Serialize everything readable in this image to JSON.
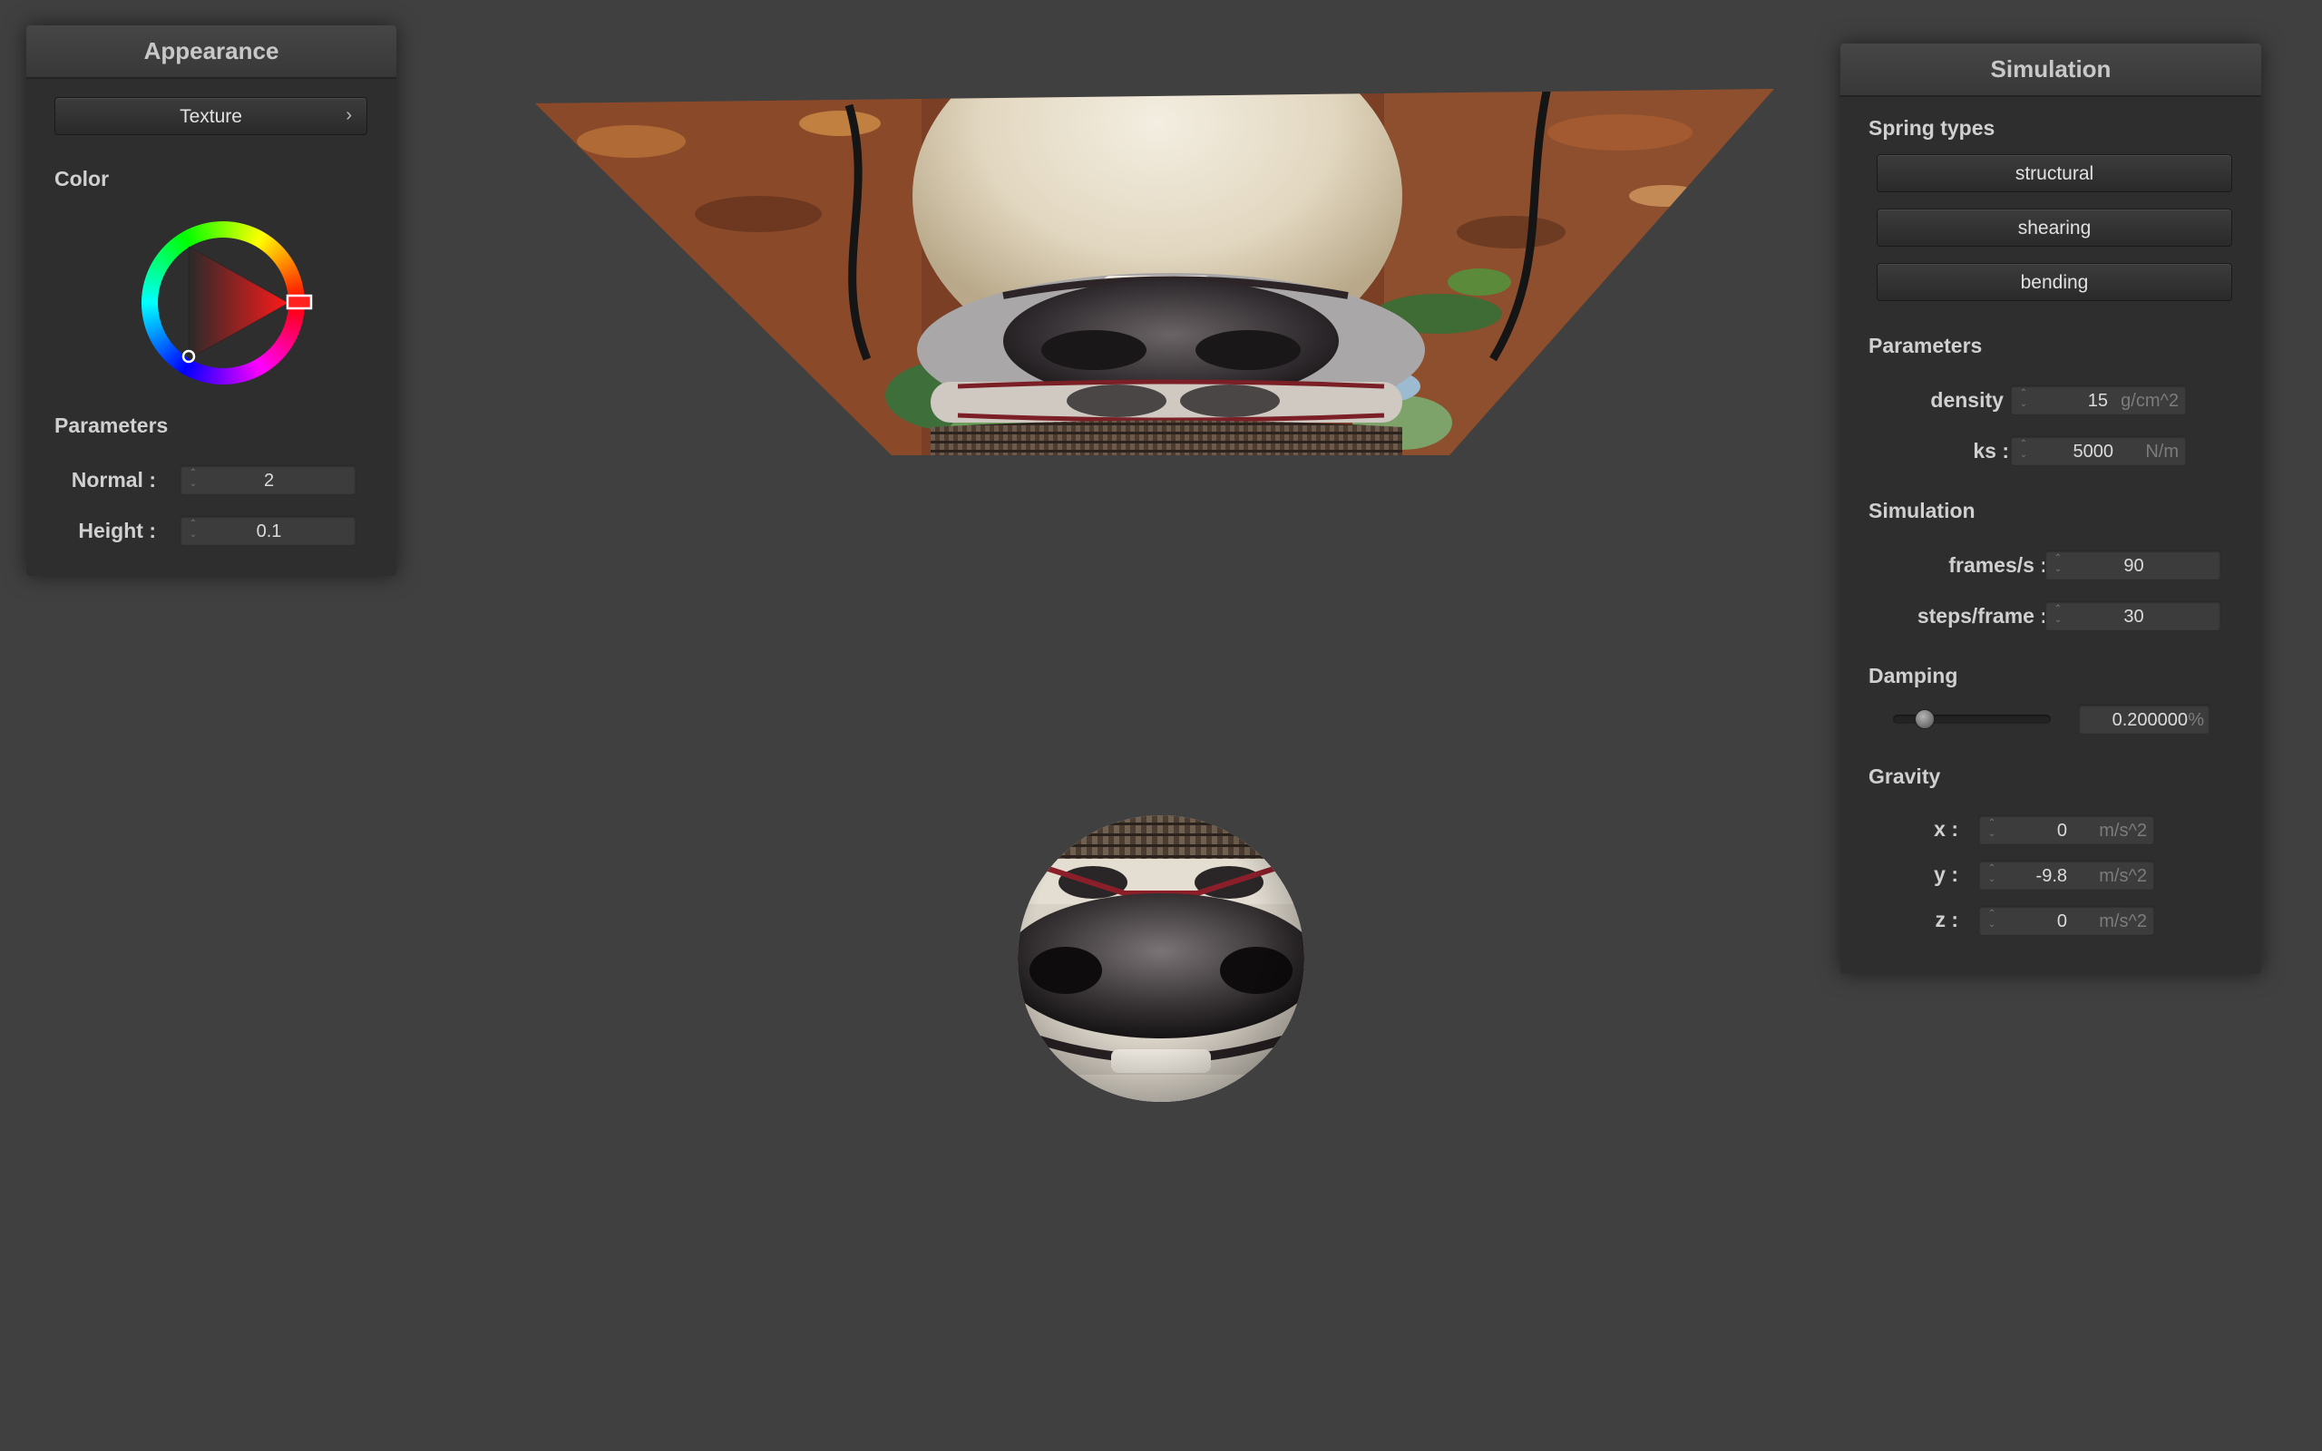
{
  "scene": {
    "cloth_texture": "dog-face-photo-texture",
    "sphere_texture": "dog-face-photo-texture"
  },
  "appearance": {
    "title": "Appearance",
    "texture_button": "Texture",
    "color_label": "Color",
    "selected_color": "#ff2020",
    "parameters_label": "Parameters",
    "normal_label": "Normal :",
    "normal_value": "2",
    "height_label": "Height :",
    "height_value": "0.1"
  },
  "simulation": {
    "title": "Simulation",
    "spring_types_label": "Spring types",
    "spring_types": [
      "structural",
      "shearing",
      "bending"
    ],
    "parameters_label": "Parameters",
    "density_label": "density :",
    "density_value": "15",
    "density_unit": "g/cm^2",
    "ks_label": "ks :",
    "ks_value": "5000",
    "ks_unit": "N/m",
    "simulation_label": "Simulation",
    "fps_label": "frames/s :",
    "fps_value": "90",
    "steps_label": "steps/frame :",
    "steps_value": "30",
    "damping_label": "Damping",
    "damping_value": "0.200000",
    "damping_unit": "%",
    "damping_fraction": 0.2,
    "gravity_label": "Gravity",
    "gx_label": "x :",
    "gx_value": "0",
    "gy_label": "y :",
    "gy_value": "-9.8",
    "gz_label": "z :",
    "gz_value": "0",
    "gravity_unit": "m/s^2"
  },
  "icons": {
    "chevron": "chevron-right-icon",
    "spinner": "spinner-arrows-icon"
  }
}
